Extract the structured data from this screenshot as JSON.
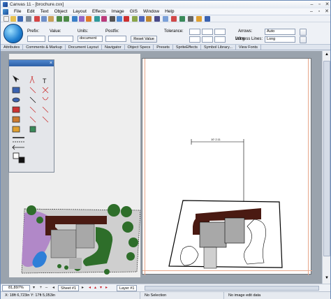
{
  "window": {
    "title": "Canvas 11 - [brochure.cvx]"
  },
  "menu": [
    "File",
    "Edit",
    "Text",
    "Object",
    "Layout",
    "Effects",
    "Image",
    "GIS",
    "Window",
    "Help"
  ],
  "properties": {
    "prefix_label": "Prefix:",
    "value_label": "Value:",
    "units_label": "Units:",
    "units_value": "document",
    "postfix_label": "Postfix:",
    "reset_button": "Reset Value",
    "tolerance_label": "Tolerance:",
    "arrows_label": "Arrows:",
    "arrows_value": "Auto",
    "witness_label": "Witness Lines:",
    "witness_value": "Long"
  },
  "tabs": [
    "Attributes",
    "Comments & Markup",
    "Document Layout",
    "Navigator",
    "Object Specs",
    "Presets",
    "SpriteEffects",
    "Symbol Library...",
    "View Fonts"
  ],
  "drawing": {
    "dimension_label": "10' 2.11"
  },
  "bottom": {
    "zoom": "81,897%",
    "sheet": "Sheet #1",
    "layer": "Layer #1"
  },
  "status": {
    "coords": "X: 18ft 6,723in  Y: 17ft 5,053in",
    "selection": "No Selection",
    "image_info": "No image edit data"
  },
  "colors": {
    "accent": "#2d5fa6",
    "house_roof": "#4a1a12",
    "house_body": "#a8a8a8",
    "grass": "#2e6e2a",
    "pool": "#2f7fd8"
  }
}
